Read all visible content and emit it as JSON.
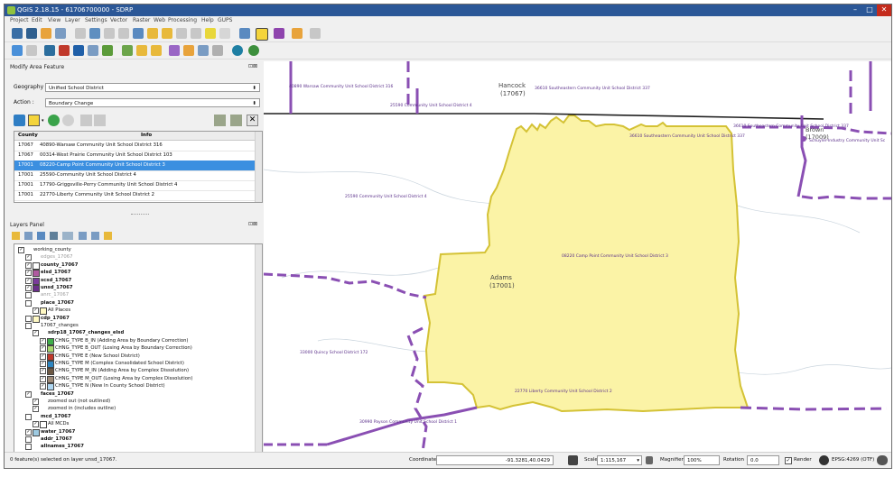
{
  "app": {
    "title": "QGIS 2.18.15 - 61706700000 - SDRP"
  },
  "menu": [
    "Project",
    "Edit",
    "View",
    "Layer",
    "Settings",
    "Vector",
    "Raster",
    "Web",
    "Processing",
    "Help",
    "GUPS"
  ],
  "toolbar_icons": [
    "save-icon",
    "open-icon",
    "pan-icon",
    "zoom-in-icon",
    "zoom-out-icon",
    "identify-icon",
    "select-icon",
    "measure-icon",
    "edit-icon",
    "add-feature-icon",
    "plugin-icon"
  ],
  "modify_panel": {
    "title": "Modify Area Feature",
    "geography_label": "Geography :",
    "geography_value": "Unified School District",
    "action_label": "Action :",
    "action_value": "Boundary Change",
    "col_county": "County",
    "col_info": "Info",
    "rows": [
      {
        "county": "17067",
        "info": "40890-Warsaw Community Unit School District 316"
      },
      {
        "county": "17067",
        "info": "00314-West Prairie Community Unit School District 103"
      },
      {
        "county": "17001",
        "info": "08220-Camp Point Community Unit School District 3"
      },
      {
        "county": "17001",
        "info": "25590-Community Unit School District 4"
      },
      {
        "county": "17001",
        "info": "17790-Griggsville-Perry Community Unit School District 4"
      },
      {
        "county": "17001",
        "info": "22770-Liberty Community Unit School District 2"
      }
    ]
  },
  "layers_panel": {
    "title": "Layers Panel",
    "items": [
      {
        "label": "working_county",
        "check": "✓",
        "indent": 0,
        "bold": false,
        "color": ""
      },
      {
        "label": "edges_17067",
        "check": "✓",
        "indent": 1,
        "bold": false,
        "color": "",
        "muted": true
      },
      {
        "label": "county_17067",
        "check": "✓",
        "indent": 1,
        "bold": true,
        "color": "#ffffff"
      },
      {
        "label": "elsd_17067",
        "check": "✓",
        "indent": 1,
        "bold": true,
        "color": "#b05aa0"
      },
      {
        "label": "scsd_17067",
        "check": "✓",
        "indent": 1,
        "bold": true,
        "color": "#7a3b9a"
      },
      {
        "label": "unsd_17067",
        "check": "✓",
        "indent": 1,
        "bold": true,
        "color": "#6a2f8a"
      },
      {
        "label": "anrc_17067",
        "check": "",
        "indent": 1,
        "bold": false,
        "color": "",
        "muted": true
      },
      {
        "label": "place_17067",
        "check": "",
        "indent": 1,
        "bold": true,
        "color": ""
      },
      {
        "label": "All Places",
        "check": "✓",
        "indent": 2,
        "bold": false,
        "color": "#fff9c4"
      },
      {
        "label": "cdp_17067",
        "check": "",
        "indent": 1,
        "bold": true,
        "color": "#fff9c4"
      },
      {
        "label": "17067_changes",
        "check": "",
        "indent": 1,
        "bold": false,
        "color": ""
      },
      {
        "label": "sdrp18_17067_changes_elsd",
        "check": "✓",
        "indent": 2,
        "bold": true,
        "color": ""
      },
      {
        "label": "CHNG_TYPE B_IN (Adding Area by Boundary Correction)",
        "check": "✓",
        "indent": 3,
        "bold": false,
        "color": "#3fae49"
      },
      {
        "label": "CHNG_TYPE B_OUT (Losing Area by Boundary Correction)",
        "check": "✓",
        "indent": 3,
        "bold": false,
        "color": "#a8d86e"
      },
      {
        "label": "CHNG_TYPE E (New School District)",
        "check": "✓",
        "indent": 3,
        "bold": false,
        "color": "#c0392b"
      },
      {
        "label": "CHNG_TYPE M (Complex Consolidated School District)",
        "check": "✓",
        "indent": 3,
        "bold": false,
        "color": "#2e86c1"
      },
      {
        "label": "CHNG_TYPE M_IN (Adding Area by Complex Dissolution)",
        "check": "✓",
        "indent": 3,
        "bold": false,
        "color": "#6c5843"
      },
      {
        "label": "CHNG_TYPE M_OUT (Losing Area by Complex Dissolution)",
        "check": "✓",
        "indent": 3,
        "bold": false,
        "color": "#9e8b78"
      },
      {
        "label": "CHNG_TYPE N (New In County School District)",
        "check": "✓",
        "indent": 3,
        "bold": false,
        "color": "#aed6f1"
      },
      {
        "label": "faces_17067",
        "check": "✓",
        "indent": 1,
        "bold": true,
        "color": ""
      },
      {
        "label": "zoomed out (not outlined)",
        "check": "✓",
        "indent": 2,
        "bold": false,
        "color": ""
      },
      {
        "label": "zoomed in (includes outline)",
        "check": "✓",
        "indent": 2,
        "bold": false,
        "color": ""
      },
      {
        "label": "mcd_17067",
        "check": "",
        "indent": 1,
        "bold": true,
        "color": ""
      },
      {
        "label": "All MCDs",
        "check": "✓",
        "indent": 2,
        "bold": false,
        "color": "#ffffff"
      },
      {
        "label": "water_17067",
        "check": "✓",
        "indent": 1,
        "bold": true,
        "color": "#9ecae1"
      },
      {
        "label": "addr_17067",
        "check": "",
        "indent": 1,
        "bold": true,
        "color": ""
      },
      {
        "label": "allnames_17067",
        "check": "",
        "indent": 1,
        "bold": true,
        "color": ""
      }
    ]
  },
  "map": {
    "labels": {
      "hancock": "Hancock",
      "hancock_code": "(17067)",
      "adams": "Adams",
      "adams_code": "(17001)",
      "brown": "Brown",
      "brown_code": "(17009)",
      "warsaw": "40890 Warsaw Community Unit School District 316",
      "southeastern_top": "36610 Southeastern Community Unit School District 337",
      "southeastern_right": "36610 Southeastern Community Unit School District 337",
      "cusd4_top": "25590 Community Unit School District 4",
      "cusd4_mid": "25590 Community Unit School District 4",
      "camp_point": "08220 Camp Point Community Unit School District 3",
      "quincy": "33000 Quincy School District 172",
      "liberty": "22770 Liberty Community Unit School District 2",
      "payson": "30990 Payson Community Unit School District 1",
      "southeastern_mid": "36610 Southeastern Community Unit School District 337",
      "schuyler": "Schuyler-Industry Community Unit Sc"
    },
    "colors": {
      "highlight_fill": "#fbf3a6",
      "highlight_stroke": "#d4c235",
      "district": "#8a4fb3",
      "county": "#1e1e1e",
      "water": "#c9d4dd"
    }
  },
  "status": {
    "message": "0 feature(s) selected on layer unsd_17067.",
    "coordinate_label": "Coordinate",
    "coordinate_value": "-91.3281,40.0429",
    "scale_label": "Scale",
    "scale_value": "1:115,167",
    "magnifier_label": "Magnifier",
    "magnifier_value": "100%",
    "rotation_label": "Rotation",
    "rotation_value": "0.0",
    "render_label": "Render",
    "crs_label": "EPSG:4269 (OTF)"
  }
}
